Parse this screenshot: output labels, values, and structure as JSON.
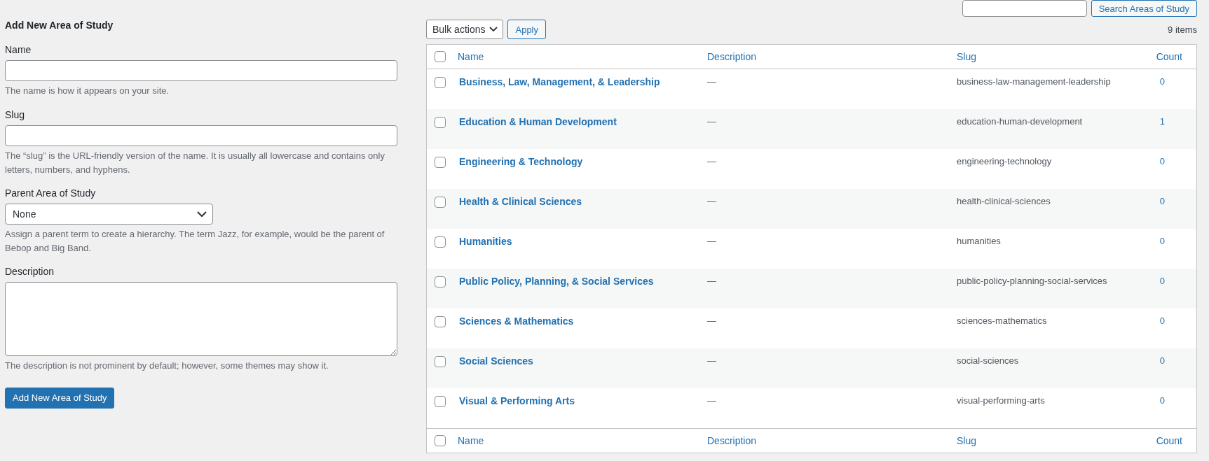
{
  "search": {
    "button": "Search Areas of Study"
  },
  "form": {
    "title": "Add New Area of Study",
    "fields": [
      {
        "kind": "text",
        "label": "Name",
        "help": "The name is how it appears on your site."
      },
      {
        "kind": "text",
        "label": "Slug",
        "help": "The “slug” is the URL-friendly version of the name. It is usually all lowercase and contains only letters, numbers, and hyphens."
      },
      {
        "kind": "select",
        "label": "Parent Area of Study",
        "value": "None",
        "help": "Assign a parent term to create a hierarchy. The term Jazz, for example, would be the parent of Bebop and Big Band."
      },
      {
        "kind": "textarea",
        "label": "Description",
        "help": "The description is not prominent by default; however, some themes may show it."
      }
    ],
    "submit": "Add New Area of Study"
  },
  "toolbar": {
    "bulk_actions": "Bulk actions",
    "apply": "Apply",
    "count": "9 items"
  },
  "table": {
    "header_checked": false,
    "columns": [
      "Name",
      "Description",
      "Slug",
      "Count"
    ],
    "rows": [
      {
        "checked": false,
        "name": "Business, Law, Management, & Leadership",
        "description": "—",
        "slug": "business-law-management-leadership",
        "count": "0"
      },
      {
        "checked": false,
        "name": "Education & Human Development",
        "description": "—",
        "slug": "education-human-development",
        "count": "1"
      },
      {
        "checked": false,
        "name": "Engineering & Technology",
        "description": "—",
        "slug": "engineering-technology",
        "count": "0"
      },
      {
        "checked": false,
        "name": "Health & Clinical Sciences",
        "description": "—",
        "slug": "health-clinical-sciences",
        "count": "0"
      },
      {
        "checked": false,
        "name": "Humanities",
        "description": "—",
        "slug": "humanities",
        "count": "0"
      },
      {
        "checked": false,
        "name": "Public Policy, Planning, & Social Services",
        "description": "—",
        "slug": "public-policy-planning-social-services",
        "count": "0"
      },
      {
        "checked": false,
        "name": "Sciences & Mathematics",
        "description": "—",
        "slug": "sciences-mathematics",
        "count": "0"
      },
      {
        "checked": false,
        "name": "Social Sciences",
        "description": "—",
        "slug": "social-sciences",
        "count": "0"
      },
      {
        "checked": false,
        "name": "Visual & Performing Arts",
        "description": "—",
        "slug": "visual-performing-arts",
        "count": "0"
      }
    ],
    "footer_checked": false,
    "footer_columns": [
      "Name",
      "Description",
      "Slug",
      "Count"
    ]
  }
}
